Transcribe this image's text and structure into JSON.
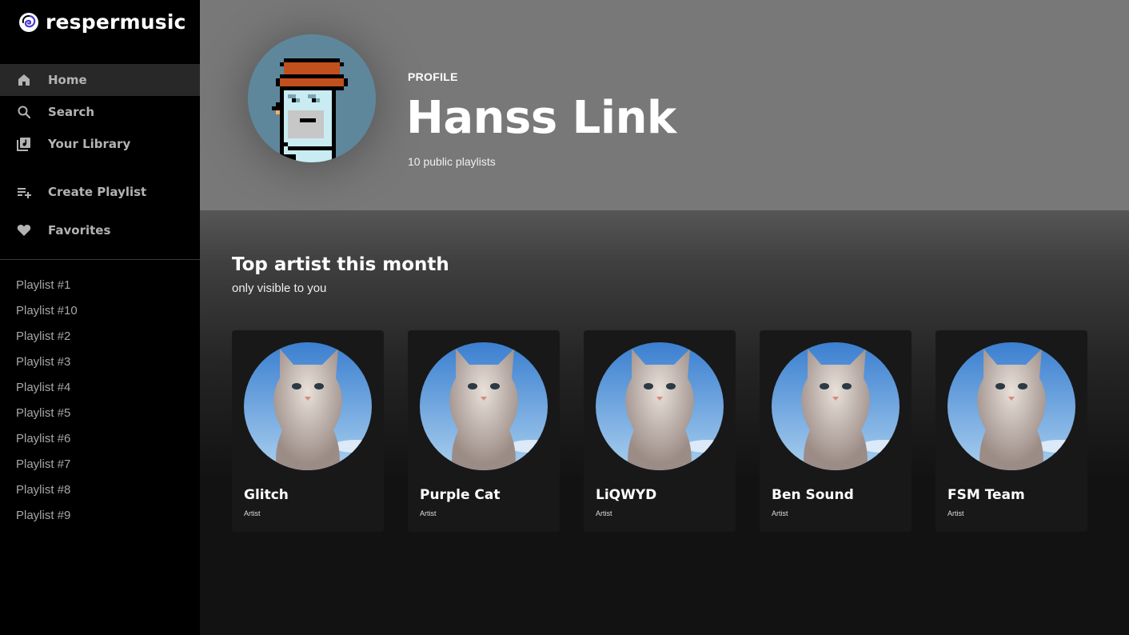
{
  "app": {
    "logo_text": "respermusic",
    "logo_icon": "swirl-logo-icon"
  },
  "sidebar": {
    "nav": [
      {
        "label": "Home",
        "icon": "home-icon",
        "active": true
      },
      {
        "label": "Search",
        "icon": "search-icon",
        "active": false
      },
      {
        "label": "Your Library",
        "icon": "library-icon",
        "active": false
      },
      {
        "label": "Create Playlist",
        "icon": "add-playlist-icon",
        "active": false
      },
      {
        "label": "Favorites",
        "icon": "heart-icon",
        "active": false
      }
    ],
    "playlists": [
      "Playlist #1",
      "Playlist #10",
      "Playlist #2",
      "Playlist #3",
      "Playlist #4",
      "Playlist #5",
      "Playlist #6",
      "Playlist #7",
      "Playlist #8",
      "Playlist #9"
    ]
  },
  "profile": {
    "kicker": "PROFILE",
    "name": "Hanss Link",
    "subtitle": "10 public playlists",
    "avatar": "pixel-art-avatar"
  },
  "top_artists": {
    "title": "Top artist this month",
    "subtitle": "only visible to you",
    "artists": [
      {
        "name": "Glitch",
        "type": "Artist"
      },
      {
        "name": "Purple Cat",
        "type": "Artist"
      },
      {
        "name": "LiQWYD",
        "type": "Artist"
      },
      {
        "name": "Ben Sound",
        "type": "Artist"
      },
      {
        "name": "FSM Team",
        "type": "Artist"
      }
    ]
  },
  "colors": {
    "sidebar_bg": "#000000",
    "active_nav_bg": "#282828",
    "header_bg": "#787878",
    "card_bg": "#181818",
    "avatar_bg": "#5f879c"
  }
}
